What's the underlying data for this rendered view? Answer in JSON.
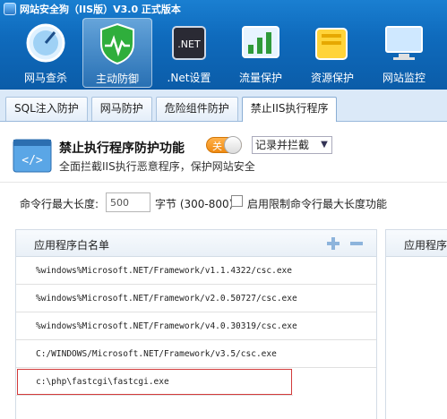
{
  "window": {
    "title": "网站安全狗（IIS版）V3.0 正式版本"
  },
  "toolbar": [
    {
      "label": "网马查杀",
      "icon": "scan-globe-icon",
      "active": false
    },
    {
      "label": "主动防御",
      "icon": "shield-heartbeat-icon",
      "active": true
    },
    {
      "label": ".Net设置",
      "icon": "dotnet-chip-icon",
      "active": false
    },
    {
      "label": "流量保护",
      "icon": "traffic-chart-icon",
      "active": false
    },
    {
      "label": "资源保护",
      "icon": "folder-lock-icon",
      "active": false
    },
    {
      "label": "网站监控",
      "icon": "monitor-icon",
      "active": false
    }
  ],
  "tabs": [
    {
      "label": "SQL注入防护",
      "active": false
    },
    {
      "label": "网马防护",
      "active": false
    },
    {
      "label": "危险组件防护",
      "active": false
    },
    {
      "label": "禁止IIS执行程序",
      "active": true
    }
  ],
  "feature": {
    "title": "禁止执行程序防护功能",
    "description": "全面拦截IIS执行恶意程序，保护网站安全",
    "toggle_label": "关",
    "mode_select": "记录并拦截",
    "accent": "#f08a12"
  },
  "settings": {
    "max_len_label": "命令行最大长度:",
    "max_len_value": "500",
    "unit_label": "字节 (300-800)",
    "limit_checkbox_label": "启用限制命令行最大长度功能"
  },
  "whitelist": {
    "header": "应用程序白名单",
    "items": [
      "%windows%Microsoft.NET/Framework/v1.1.4322/csc.exe",
      "%windows%Microsoft.NET/Framework/v2.0.50727/csc.exe",
      "%windows%Microsoft.NET/Framework/v4.0.30319/csc.exe",
      "C:/WINDOWS/Microsoft.NET/Framework/v3.5/csc.exe",
      "c:\\php\\fastcgi\\fastcgi.exe"
    ],
    "highlighted_index": 4,
    "highlight_color": "#d23a3a"
  },
  "right_panel": {
    "header": "应用程序黑"
  }
}
